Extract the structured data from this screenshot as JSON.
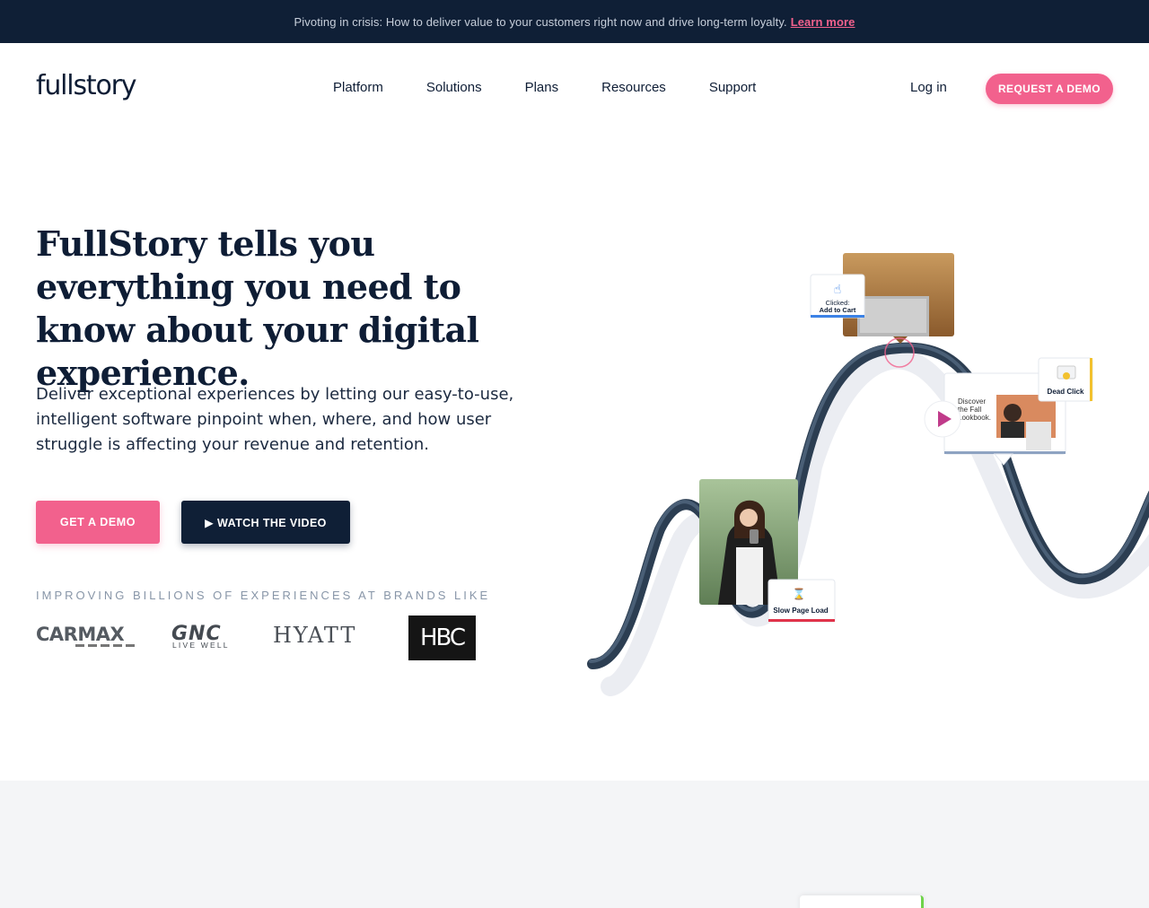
{
  "announcement": {
    "text": "Pivoting in crisis: How to deliver value to your customers right now and drive long-term loyalty.",
    "link": "Learn more"
  },
  "nav": {
    "logo": "fullstory",
    "items": [
      "Platform",
      "Solutions",
      "Plans",
      "Resources",
      "Support"
    ],
    "login": "Log in",
    "cta": "REQUEST A DEMO"
  },
  "hero": {
    "title": "FullStory tells you everything you need to know about your digital experience.",
    "subtitle": "Deliver exceptional experiences by letting our easy-to-use, intelligent software pinpoint when, where, and how user struggle is affecting your revenue and retention.",
    "primary_button": "GET A DEMO",
    "secondary_button": "▶ WATCH THE VIDEO"
  },
  "brands": {
    "label": "IMPROVING BILLIONS OF EXPERIENCES AT BRANDS LIKE",
    "logos": {
      "carmax": "CARMAX",
      "gnc": "GNC",
      "gnc_tag": "LIVE WELL",
      "hyatt": "HYATT",
      "hbc": "HBC"
    }
  },
  "illustration": {
    "card_clicked_line1": "Clicked:",
    "card_clicked_line2": "Add to Cart",
    "card_dead_click": "Dead Click",
    "card_slow_page": "Slow Page Load",
    "lookbook_text_1": "Discover",
    "lookbook_text_2": "the Fall",
    "lookbook_text_3": "Lookbook."
  },
  "colors": {
    "accent": "#f2618d",
    "navy": "#0f1f36",
    "band": "#f4f5f7"
  }
}
